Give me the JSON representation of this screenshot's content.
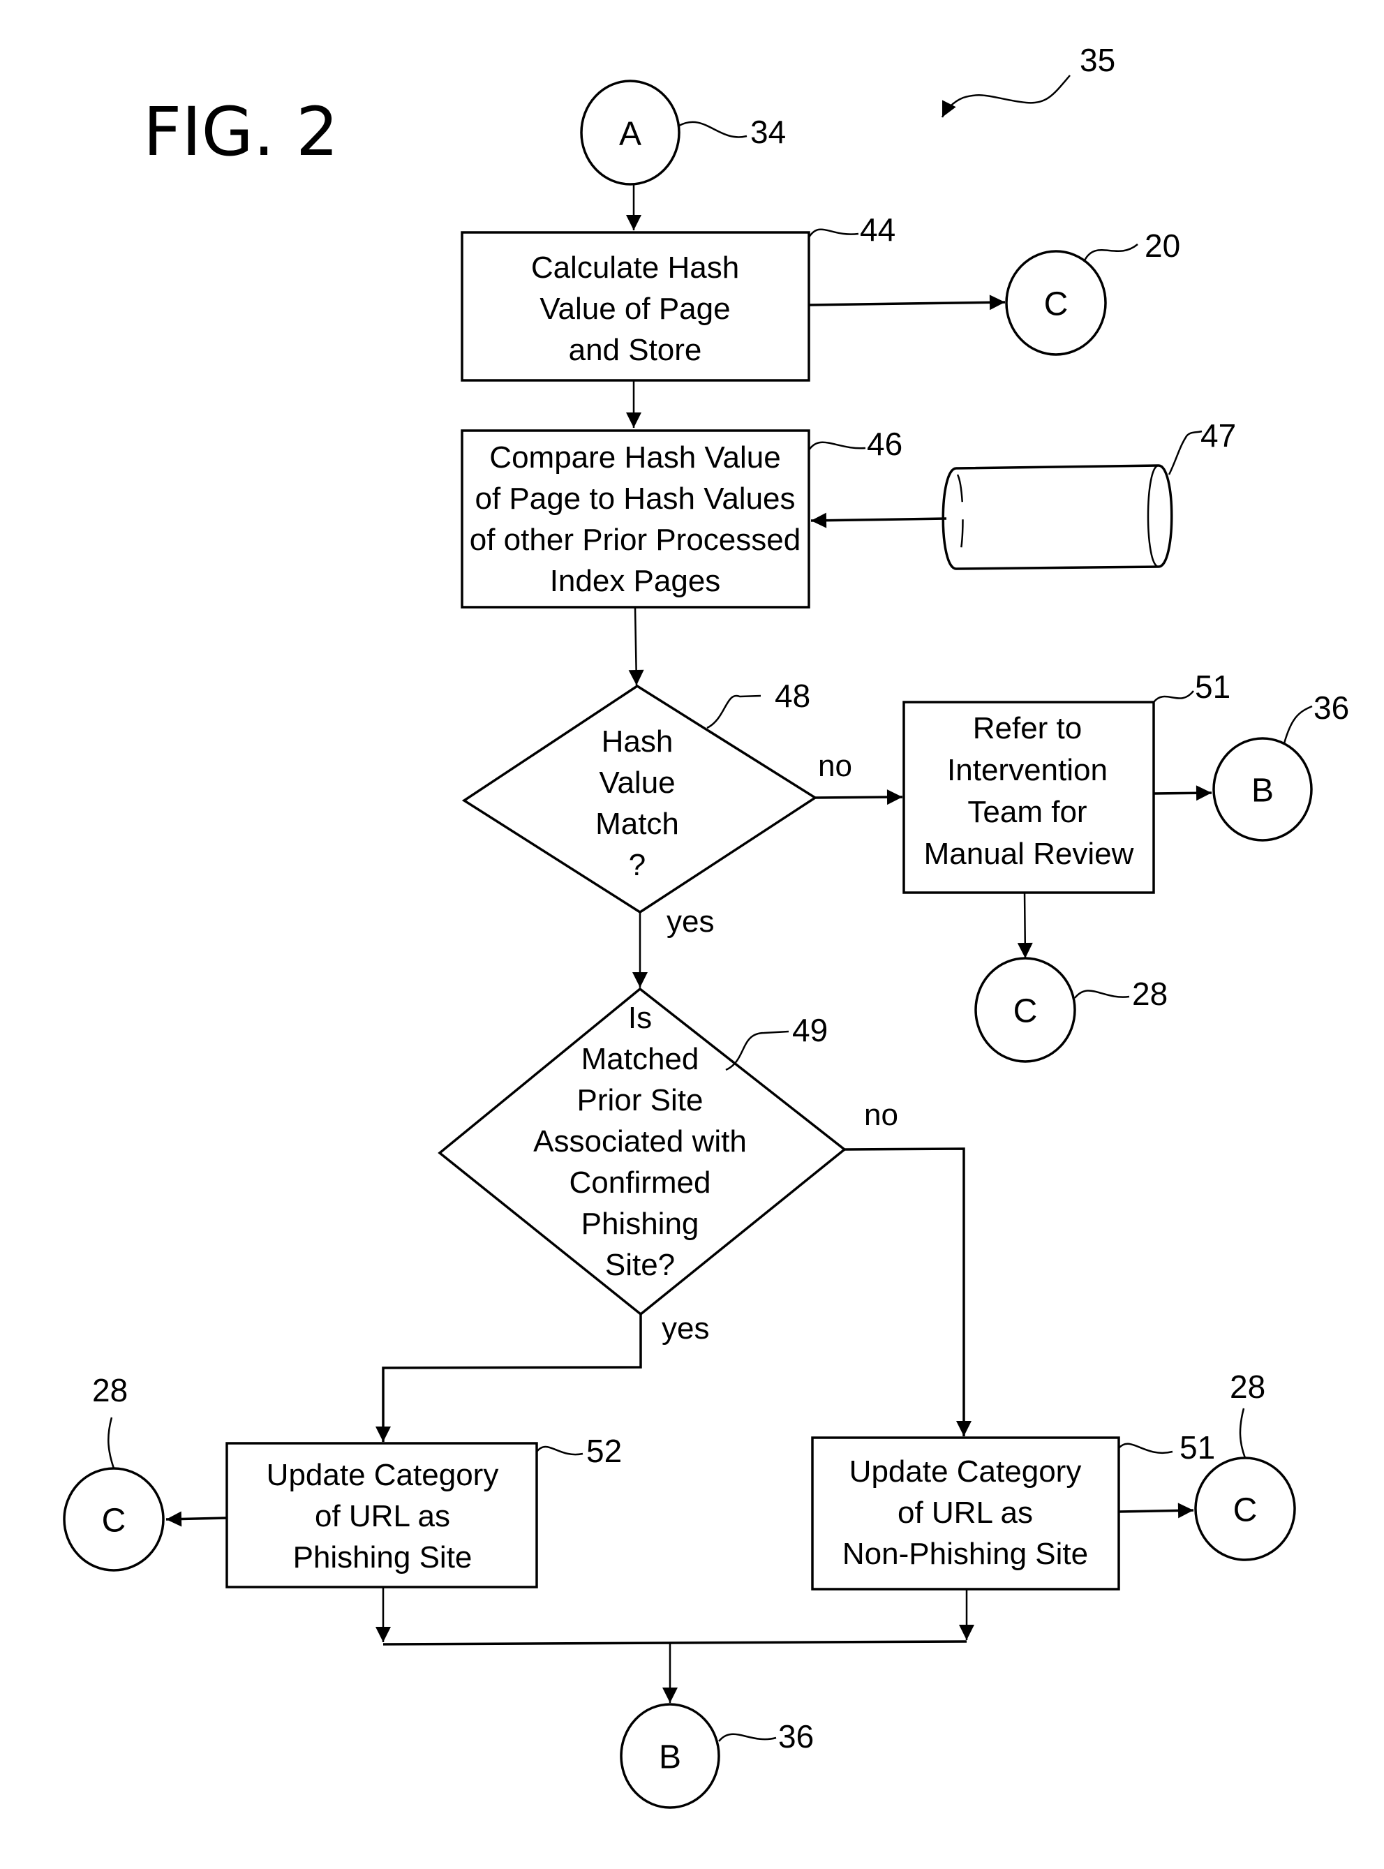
{
  "figure": {
    "title": "FIG. 2",
    "reference": "35"
  },
  "connectors": {
    "start_a": {
      "letter": "A",
      "ref": "34"
    },
    "c_top": {
      "letter": "C",
      "ref": "20"
    },
    "b_right": {
      "letter": "B",
      "ref": "36"
    },
    "c_mid": {
      "letter": "C",
      "ref": "28"
    },
    "c_left": {
      "letter": "C",
      "ref": "28"
    },
    "c_right": {
      "letter": "C",
      "ref": "28"
    },
    "b_bottom": {
      "letter": "B",
      "ref": "36"
    }
  },
  "steps": {
    "calc_hash": {
      "ref": "44",
      "lines": [
        "Calculate Hash",
        "Value of Page",
        "and Store"
      ]
    },
    "compare_hash": {
      "ref": "46",
      "lines": [
        "Compare Hash Value",
        "of Page to Hash Values",
        "of other Prior Processed",
        "Index Pages"
      ]
    },
    "database": {
      "ref": "47"
    },
    "refer_review": {
      "ref": "51",
      "lines": [
        "Refer to",
        "Intervention",
        "Team for",
        "Manual Review"
      ]
    },
    "update_phishing": {
      "ref": "52",
      "lines": [
        "Update Category",
        "of URL as",
        "Phishing Site"
      ]
    },
    "update_non_phishing": {
      "ref": "51",
      "lines": [
        "Update Category",
        "of URL as",
        "Non-Phishing Site"
      ]
    }
  },
  "decisions": {
    "hash_match": {
      "ref": "48",
      "lines": [
        "Hash",
        "Value",
        "Match",
        "?"
      ],
      "yes_label": "yes",
      "no_label": "no"
    },
    "confirmed_phishing": {
      "ref": "49",
      "lines": [
        "Is",
        "Matched",
        "Prior Site",
        "Associated with",
        "Confirmed",
        "Phishing",
        "Site?"
      ],
      "yes_label": "yes",
      "no_label": "no"
    }
  }
}
